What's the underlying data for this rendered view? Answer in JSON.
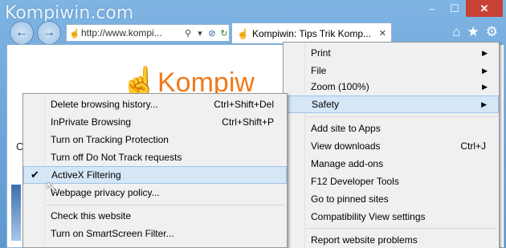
{
  "watermark": "Kompiwin.com",
  "window": {
    "minimize": "–",
    "maximize": "☐",
    "close": "✕"
  },
  "nav": {
    "back_icon": "back-arrow-icon",
    "forward_icon": "forward-arrow-icon"
  },
  "address_bar": {
    "url": "http://www.kompi...",
    "search_glyph": "⚲",
    "dropdown_glyph": "▾",
    "stop_glyph": "⊘",
    "refresh_glyph": "↻"
  },
  "tab": {
    "title": "Kompiwin: Tips Trik Komp...",
    "close": "✕"
  },
  "toolbar": {
    "home": "⌂",
    "favorites": "★",
    "tools": "⚙"
  },
  "page": {
    "logo_text": "Kompiw",
    "hand": "☝",
    "left_letter": "C"
  },
  "tools_menu": {
    "items": [
      {
        "label": "Print",
        "submenu": true
      },
      {
        "label": "File",
        "submenu": true
      },
      {
        "label": "Zoom (100%)",
        "submenu": true
      },
      {
        "label": "Safety",
        "submenu": true
      },
      {
        "label": "Add site to Apps"
      },
      {
        "label": "View downloads",
        "shortcut": "Ctrl+J"
      },
      {
        "label": "Manage add-ons"
      },
      {
        "label": "F12 Developer Tools"
      },
      {
        "label": "Go to pinned sites"
      },
      {
        "label": "Compatibility View settings"
      },
      {
        "label": "Report website problems"
      }
    ]
  },
  "safety_menu": {
    "items": [
      {
        "label": "Delete browsing history...",
        "shortcut": "Ctrl+Shift+Del"
      },
      {
        "label": "InPrivate Browsing",
        "shortcut": "Ctrl+Shift+P"
      },
      {
        "label": "Turn on Tracking Protection"
      },
      {
        "label": "Turn off Do Not Track requests"
      },
      {
        "label": "ActiveX Filtering",
        "checked": "✔"
      },
      {
        "label": "Webpage privacy policy..."
      },
      {
        "label": "Check this website"
      },
      {
        "label": "Turn on SmartScreen Filter..."
      }
    ]
  },
  "arrow": "▶"
}
